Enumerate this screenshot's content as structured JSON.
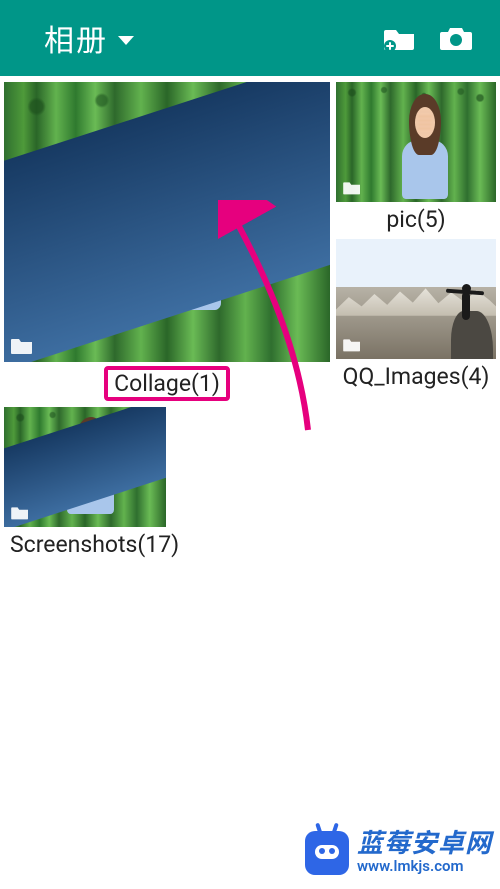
{
  "header": {
    "title": "相册",
    "actions": {
      "new_folder_icon": "new-folder-icon",
      "camera_icon": "camera-icon"
    }
  },
  "albums": {
    "collage": {
      "label": "Collage(1)"
    },
    "pic": {
      "label": "pic(5)"
    },
    "qq_images": {
      "label": "QQ_Images(4)"
    },
    "screenshots": {
      "label": "Screenshots(17)"
    }
  },
  "watermark": {
    "title": "蓝莓安卓网",
    "url": "www.lmkjs.com"
  }
}
